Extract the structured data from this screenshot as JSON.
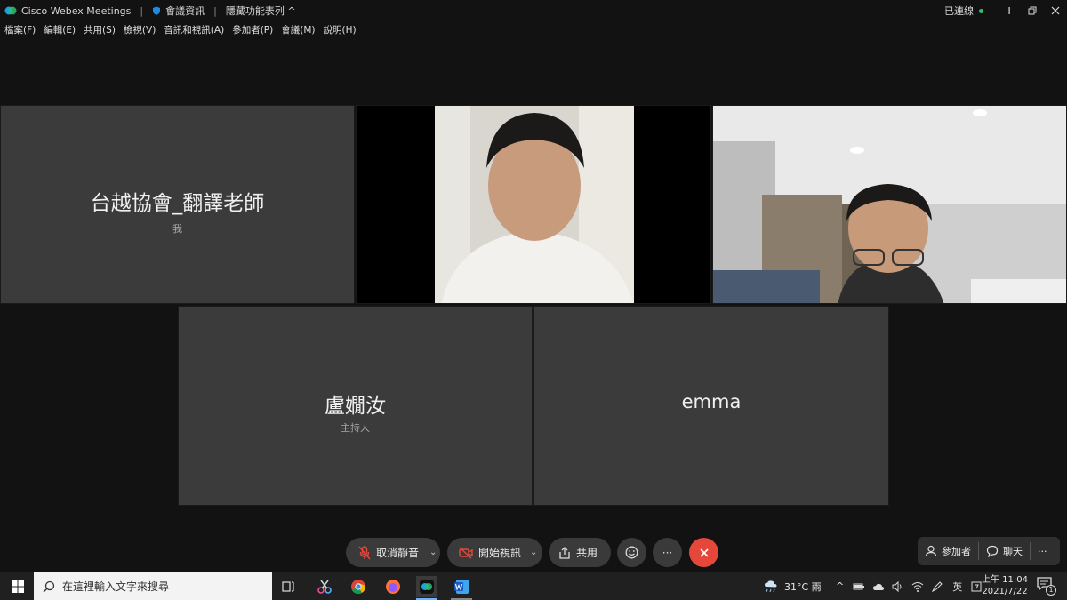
{
  "window": {
    "app_title": "Cisco Webex Meetings",
    "meeting_info": "會議資訊",
    "hide_toolbar": "隱藏功能表列",
    "connection_status": "已連線"
  },
  "menu": [
    "檔案(F)",
    "編輯(E)",
    "共用(S)",
    "檢視(V)",
    "音訊和視訊(A)",
    "參加者(P)",
    "會議(M)",
    "說明(H)"
  ],
  "tiles": {
    "self": {
      "name": "台越協會_翻譯老師",
      "sub": "我"
    },
    "host": {
      "name": "盧嫺汝",
      "sub": "主持人"
    },
    "emma": {
      "name": "emma"
    }
  },
  "controls": {
    "unmute": "取消靜音",
    "start_video": "開始視訊",
    "share": "共用",
    "more": "···",
    "participants": "參加者",
    "chat": "聊天"
  },
  "colors": {
    "accent_red": "#e5483b",
    "connected_green": "#2fbf71"
  },
  "taskbar": {
    "search_placeholder": "在這裡輸入文字來搜尋",
    "weather": "31°C 雨",
    "ime": "英",
    "time": "上午 11:04",
    "date": "2021/7/22",
    "notification_count": "1"
  }
}
